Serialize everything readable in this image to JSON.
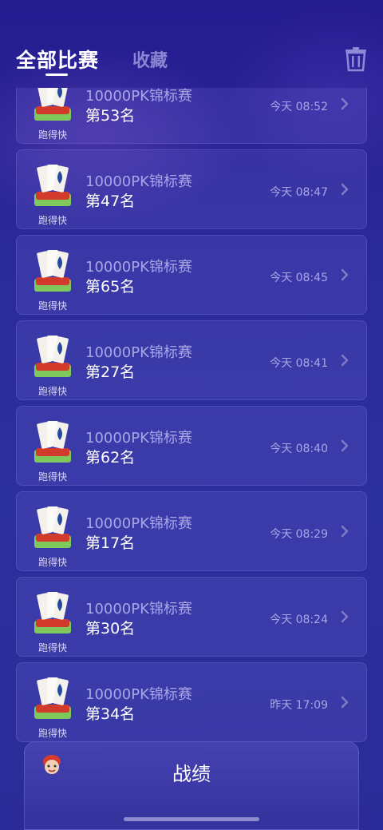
{
  "header": {
    "tab_all": "全部比赛",
    "tab_favorites": "收藏",
    "trash_icon": "trash-icon"
  },
  "cards": [
    {
      "title": "10000PK锦标赛",
      "rank": "第53名",
      "time": "今天 08:52",
      "game": "跑得快"
    },
    {
      "title": "10000PK锦标赛",
      "rank": "第47名",
      "time": "今天 08:47",
      "game": "跑得快"
    },
    {
      "title": "10000PK锦标赛",
      "rank": "第65名",
      "time": "今天 08:45",
      "game": "跑得快"
    },
    {
      "title": "10000PK锦标赛",
      "rank": "第27名",
      "time": "今天 08:41",
      "game": "跑得快"
    },
    {
      "title": "10000PK锦标赛",
      "rank": "第62名",
      "time": "今天 08:40",
      "game": "跑得快"
    },
    {
      "title": "10000PK锦标赛",
      "rank": "第17名",
      "time": "今天 08:29",
      "game": "跑得快"
    },
    {
      "title": "10000PK锦标赛",
      "rank": "第30名",
      "time": "今天 08:24",
      "game": "跑得快"
    },
    {
      "title": "10000PK锦标赛",
      "rank": "第34名",
      "time": "昨天 17:09",
      "game": "跑得快"
    }
  ],
  "bottom": {
    "record_title": "战绩"
  },
  "colors": {
    "background": "#2b2a9a",
    "card_border": "#aaa0ff",
    "muted_text": "#a9a6e6"
  }
}
